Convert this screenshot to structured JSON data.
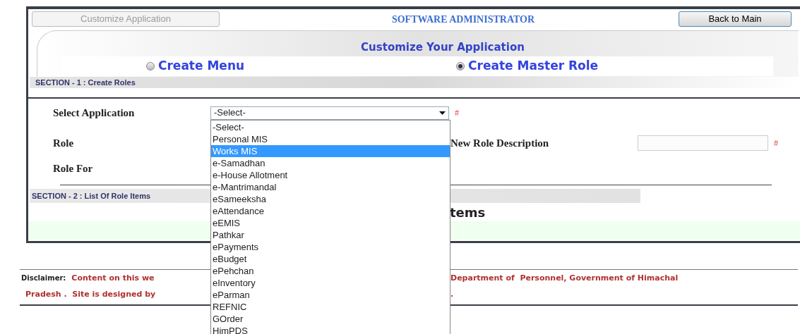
{
  "top_bar": {
    "left_button": {
      "label": "Customize Application",
      "disabled": true
    },
    "title": "SOFTWARE ADMINISTRATOR",
    "right_button": {
      "label": "Back to Main"
    }
  },
  "panel_title": "Customize Your Application",
  "mode_options": [
    {
      "label": "Create Menu",
      "selected": false
    },
    {
      "label": "Create Master Role",
      "selected": true
    }
  ],
  "section_1": {
    "title": "SECTION - 1 : Create Roles"
  },
  "form": {
    "select_application": {
      "label": "Select Application",
      "value": "-Select-",
      "required_mark": "#",
      "options": [
        {
          "label": "-Select-",
          "highlighted": false
        },
        {
          "label": "Personal MIS",
          "highlighted": false
        },
        {
          "label": "Works MIS",
          "highlighted": true
        },
        {
          "label": "e-Samadhan",
          "highlighted": false
        },
        {
          "label": "e-House Allotment",
          "highlighted": false
        },
        {
          "label": "e-Mantrimandal",
          "highlighted": false
        },
        {
          "label": "eSameeksha",
          "highlighted": false
        },
        {
          "label": "eAttendance",
          "highlighted": false
        },
        {
          "label": "eEMIS",
          "highlighted": false
        },
        {
          "label": "Pathkar",
          "highlighted": false
        },
        {
          "label": "ePayments",
          "highlighted": false
        },
        {
          "label": "eBudget",
          "highlighted": false
        },
        {
          "label": "ePehchan",
          "highlighted": false
        },
        {
          "label": "eInventory",
          "highlighted": false
        },
        {
          "label": "eParman",
          "highlighted": false
        },
        {
          "label": "REFNIC",
          "highlighted": false
        },
        {
          "label": "GOrder",
          "highlighted": false
        },
        {
          "label": "HimPDS",
          "highlighted": false
        }
      ]
    },
    "role_label": "Role",
    "new_role_description": {
      "label": "New Role Description",
      "required_mark": "#"
    },
    "role_for_label": "Role For"
  },
  "section_2": {
    "title": "SECTION - 2 : List Of Role Items",
    "heading_visible_part": "tems"
  },
  "disclaimer": {
    "label": "Disclaimer:",
    "line_1_left": "Content on this we",
    "line_1_right": "Department of  Personnel, Government of Himachal",
    "line_2_left": "Pradesh .  Site is designed by",
    "line_2_right": "."
  }
}
